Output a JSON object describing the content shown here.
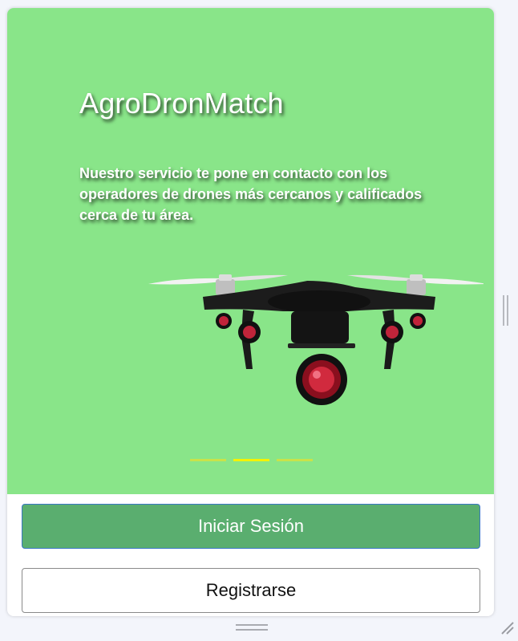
{
  "app": {
    "title": "AgroDronMatch",
    "description": "Nuestro servicio te pone en contacto con los operadores de drones más cercanos y calificados cerca de tu área."
  },
  "hero": {
    "background_color": "#89e589",
    "illustration": "drone-icon"
  },
  "carousel": {
    "slides_total": 3,
    "active_index": 1,
    "active_color": "#f4f200",
    "inactive_color": "#c9e24a"
  },
  "actions": {
    "login_label": "Iniciar Sesión",
    "register_label": "Registrarse",
    "login_color": "#5aae6f"
  }
}
